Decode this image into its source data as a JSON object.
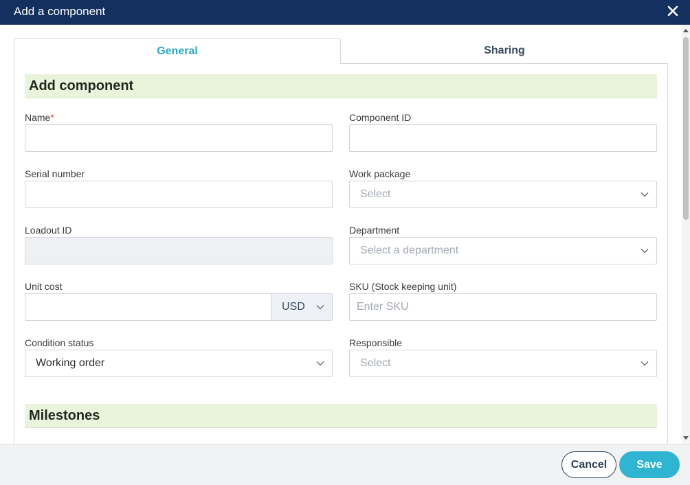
{
  "window": {
    "title": "Add a component"
  },
  "tabs": [
    {
      "label": "General",
      "active": true
    },
    {
      "label": "Sharing",
      "active": false
    }
  ],
  "sections": {
    "add_component": "Add component",
    "milestones": "Milestones"
  },
  "form": {
    "name": {
      "label": "Name",
      "required_mark": "*",
      "value": ""
    },
    "component_id": {
      "label": "Component ID",
      "value": ""
    },
    "serial_number": {
      "label": "Serial number",
      "value": ""
    },
    "work_package": {
      "label": "Work package",
      "placeholder": "Select"
    },
    "loadout_id": {
      "label": "Loadout ID",
      "value": ""
    },
    "department": {
      "label": "Department",
      "placeholder": "Select a department"
    },
    "unit_cost": {
      "label": "Unit cost",
      "value": "",
      "currency": "USD"
    },
    "sku": {
      "label": "SKU (Stock keeping unit)",
      "placeholder": "Enter SKU"
    },
    "condition_status": {
      "label": "Condition status",
      "value": "Working order"
    },
    "responsible": {
      "label": "Responsible",
      "placeholder": "Select"
    }
  },
  "footer": {
    "cancel_label": "Cancel",
    "save_label": "Save"
  },
  "colors": {
    "header_bg": "#14305e",
    "accent": "#2fb4d1",
    "section_bg": "#eaf3dc",
    "required": "#d23c3c"
  }
}
